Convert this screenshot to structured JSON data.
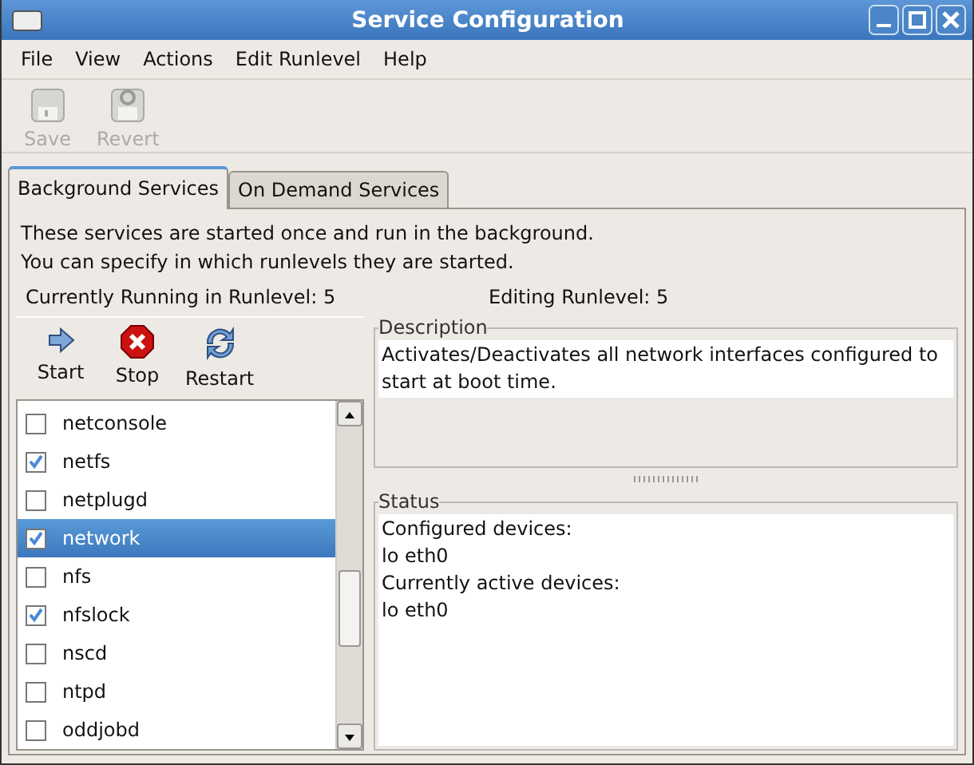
{
  "window": {
    "title": "Service Configuration"
  },
  "menu": [
    "File",
    "View",
    "Actions",
    "Edit Runlevel",
    "Help"
  ],
  "toolbar": [
    {
      "kind": "save",
      "label": "Save",
      "disabled": true
    },
    {
      "kind": "revert",
      "label": "Revert",
      "disabled": true
    }
  ],
  "tabs": [
    {
      "label": "Background Services",
      "selected": true
    },
    {
      "label": "On Demand Services",
      "selected": false
    }
  ],
  "intro": [
    "These services are started once and run in the background.",
    "You can specify in which runlevels they are started."
  ],
  "running_runlevel": "Currently Running in Runlevel: 5",
  "editing_runlevel": "Editing Runlevel: 5",
  "actions": [
    {
      "kind": "start",
      "label": "Start"
    },
    {
      "kind": "stop",
      "label": "Stop"
    },
    {
      "kind": "restart",
      "label": "Restart"
    }
  ],
  "services": [
    {
      "name": "netconsole",
      "checked": false,
      "selected": false
    },
    {
      "name": "netfs",
      "checked": true,
      "selected": false
    },
    {
      "name": "netplugd",
      "checked": false,
      "selected": false
    },
    {
      "name": "network",
      "checked": true,
      "selected": true
    },
    {
      "name": "nfs",
      "checked": false,
      "selected": false
    },
    {
      "name": "nfslock",
      "checked": true,
      "selected": false
    },
    {
      "name": "nscd",
      "checked": false,
      "selected": false
    },
    {
      "name": "ntpd",
      "checked": false,
      "selected": false
    },
    {
      "name": "oddjobd",
      "checked": false,
      "selected": false
    }
  ],
  "description": {
    "title": "Description",
    "text": "Activates/Deactivates all network interfaces configured to start at boot time."
  },
  "status": {
    "title": "Status",
    "lines": [
      "Configured devices:",
      "lo eth0",
      "Currently active devices:",
      "lo eth0"
    ]
  }
}
